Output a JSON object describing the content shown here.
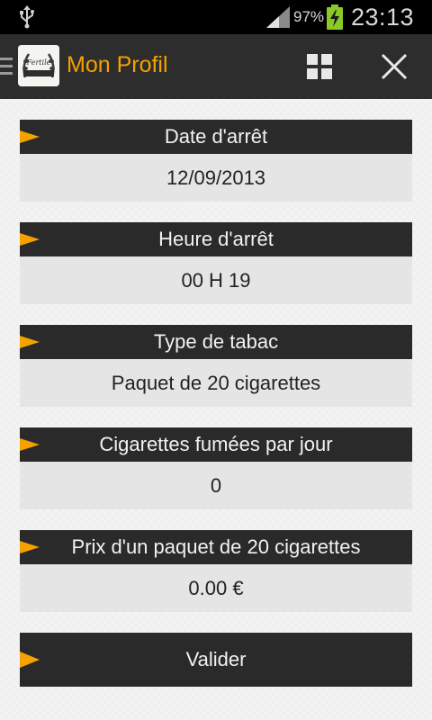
{
  "status_bar": {
    "battery_percent": "97%",
    "time": "23:13",
    "battery_color": "#8ac926"
  },
  "action_bar": {
    "title": "Mon Profil",
    "title_color": "#f5a100",
    "logo_text": "Fertile"
  },
  "accent_color": "#f5a100",
  "fields": [
    {
      "label": "Date d'arrêt",
      "value": "12/09/2013"
    },
    {
      "label": "Heure d'arrêt",
      "value": "00 H 19"
    },
    {
      "label": "Type de tabac",
      "value": "Paquet de 20 cigarettes"
    },
    {
      "label": "Cigarettes fumées par jour",
      "value": "0"
    },
    {
      "label": "Prix d'un paquet de 20 cigarettes",
      "value": "0.00 €"
    }
  ],
  "validate_label": "Valider"
}
